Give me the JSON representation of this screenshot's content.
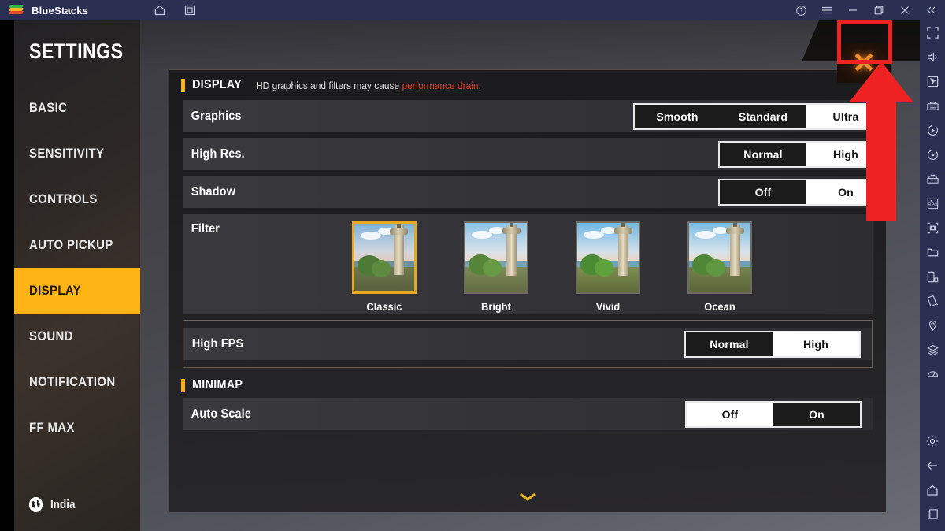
{
  "titlebar": {
    "app_name": "BlueStacks",
    "logo_icon": "bluestacks-logo",
    "center_icons": [
      "home-icon",
      "multi-instance-icon"
    ],
    "right_icons": [
      "help-icon",
      "menu-icon",
      "minimize-icon",
      "maximize-icon",
      "close-icon",
      "collapse-icon"
    ]
  },
  "sidetools": {
    "icons": [
      "fullscreen-icon",
      "volume-icon",
      "pointer-icon",
      "keymapping-icon",
      "macro-play-icon",
      "record-icon",
      "multi-instance-manager-icon",
      "rpg-mode-icon",
      "screenshot-icon",
      "media-folder-icon",
      "copy-to-phone-icon",
      "shake-icon",
      "location-icon",
      "layers-icon",
      "gamepad-icon"
    ],
    "bottom_icons": [
      "settings-gear-icon",
      "back-icon",
      "home-icon",
      "recents-icon"
    ]
  },
  "settings": {
    "title": "SETTINGS",
    "menu": [
      {
        "label": "BASIC",
        "active": false
      },
      {
        "label": "SENSITIVITY",
        "active": false
      },
      {
        "label": "CONTROLS",
        "active": false
      },
      {
        "label": "AUTO PICKUP",
        "active": false
      },
      {
        "label": "DISPLAY",
        "active": true
      },
      {
        "label": "SOUND",
        "active": false
      },
      {
        "label": "NOTIFICATION",
        "active": false
      },
      {
        "label": "FF MAX",
        "active": false
      }
    ],
    "locale": {
      "icon": "globe-icon",
      "label": "India"
    }
  },
  "display": {
    "section_title": "DISPLAY",
    "section_note_plain": "HD graphics and filters may cause ",
    "section_note_warning": "performance drain",
    "section_note_end": ".",
    "rows": [
      {
        "label": "Graphics",
        "options": [
          "Smooth",
          "Standard",
          "Ultra"
        ],
        "selected": "Ultra"
      },
      {
        "label": "High Res.",
        "options": [
          "Normal",
          "High"
        ],
        "selected": "High"
      },
      {
        "label": "Shadow",
        "options": [
          "Off",
          "On"
        ],
        "selected": "On"
      }
    ],
    "filter_row_label": "Filter",
    "filters": [
      {
        "name": "Classic",
        "selected": true
      },
      {
        "name": "Bright",
        "selected": false
      },
      {
        "name": "Vivid",
        "selected": false
      },
      {
        "name": "Ocean",
        "selected": false
      }
    ],
    "high_fps": {
      "label": "High FPS",
      "options": [
        "Normal",
        "High"
      ],
      "selected": "High"
    },
    "minimap_title": "MINIMAP",
    "auto_scale": {
      "label": "Auto Scale",
      "options": [
        "Off",
        "On"
      ],
      "selected": "Off"
    },
    "scroll_hint_icon": "chevron-down-icon",
    "close_label": "✕"
  },
  "annotation": {
    "highlight_color": "#ee2222",
    "arrow_color": "#ee2222",
    "target": "close-settings-button"
  }
}
